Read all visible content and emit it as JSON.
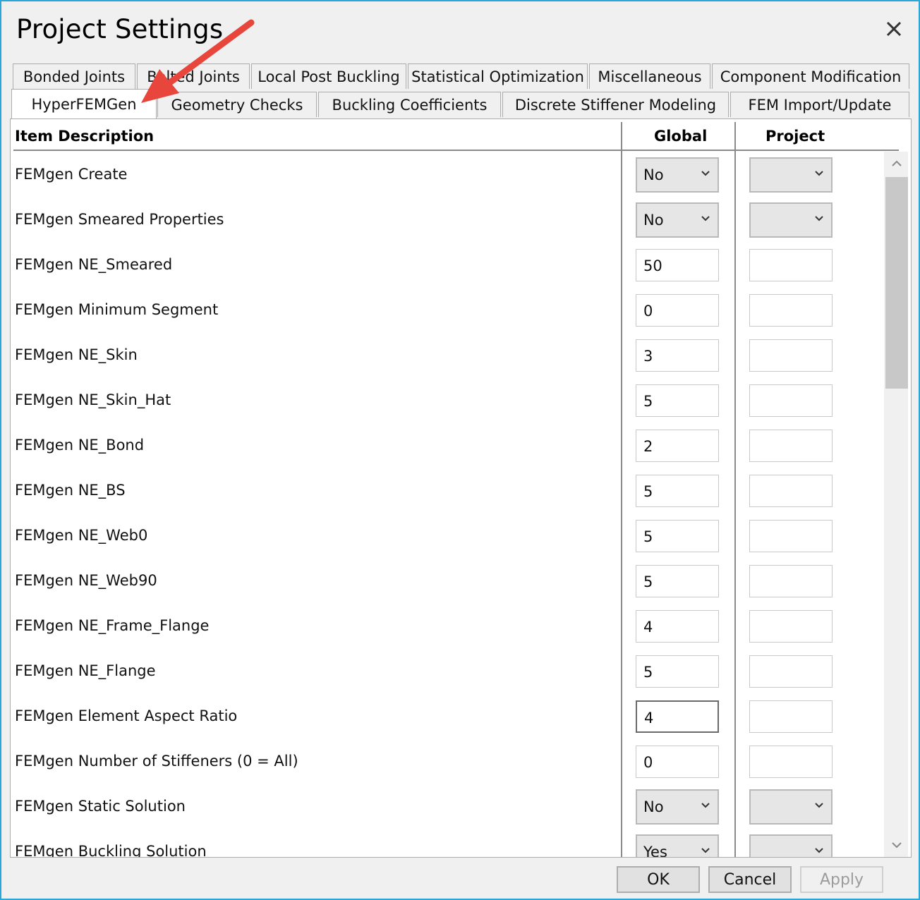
{
  "window": {
    "title": "Project Settings"
  },
  "tabs_row1": [
    "Bonded Joints",
    "Bolted Joints",
    "Local Post Buckling",
    "Statistical Optimization",
    "Miscellaneous",
    "Component Modification"
  ],
  "tabs_row2": [
    "HyperFEMGen",
    "Geometry Checks",
    "Buckling Coefficients",
    "Discrete Stiffener Modeling",
    "FEM Import/Update"
  ],
  "active_tab": "HyperFEMGen",
  "table": {
    "headers": {
      "item": "Item Description",
      "global": "Global",
      "project": "Project"
    },
    "rows": [
      {
        "label": "FEMgen Create",
        "global": "No",
        "project": ""
      },
      {
        "label": "FEMgen Smeared Properties",
        "global": "No",
        "project": ""
      },
      {
        "label": "FEMgen NE_Smeared",
        "global": "50",
        "project": ""
      },
      {
        "label": "FEMgen Minimum Segment",
        "global": "0",
        "project": ""
      },
      {
        "label": "FEMgen NE_Skin",
        "global": "3",
        "project": ""
      },
      {
        "label": "FEMgen NE_Skin_Hat",
        "global": "5",
        "project": ""
      },
      {
        "label": "FEMgen NE_Bond",
        "global": "2",
        "project": ""
      },
      {
        "label": "FEMgen NE_BS",
        "global": "5",
        "project": ""
      },
      {
        "label": "FEMgen NE_Web0",
        "global": "5",
        "project": ""
      },
      {
        "label": "FEMgen NE_Web90",
        "global": "5",
        "project": ""
      },
      {
        "label": "FEMgen NE_Frame_Flange",
        "global": "4",
        "project": ""
      },
      {
        "label": "FEMgen NE_Flange",
        "global": "5",
        "project": ""
      },
      {
        "label": "FEMgen Element Aspect Ratio",
        "global": "4",
        "project": ""
      },
      {
        "label": "FEMgen Number of Stiffeners (0 = All)",
        "global": "0",
        "project": ""
      },
      {
        "label": "FEMgen Static Solution",
        "global": "No",
        "project": ""
      },
      {
        "label": "FEMgen Buckling Solution",
        "global": "Yes",
        "project": ""
      }
    ]
  },
  "buttons": {
    "ok": "OK",
    "cancel": "Cancel",
    "apply": "Apply"
  },
  "colors": {
    "window_border": "#2aa6d8",
    "annotation_arrow": "#e8453c"
  },
  "icons": {
    "close": "close-icon",
    "dropdown": "chevron-down-icon",
    "scroll_up": "chevron-up-icon",
    "scroll_down": "chevron-down-icon"
  }
}
